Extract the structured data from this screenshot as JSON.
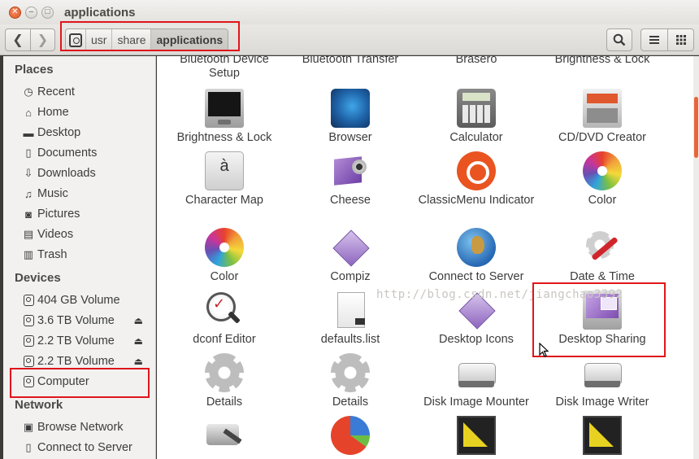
{
  "window": {
    "title": "applications"
  },
  "toolbar": {
    "back_icon": "chevron-left-icon",
    "forward_icon": "chevron-right-icon",
    "breadcrumbs": [
      "usr",
      "share",
      "applications"
    ],
    "search_icon": "search-icon",
    "list_view_icon": "list-view-icon",
    "grid_view_icon": "grid-view-icon"
  },
  "sidebar": {
    "places_heading": "Places",
    "places": [
      {
        "label": "Recent",
        "icon": "clock-icon"
      },
      {
        "label": "Home",
        "icon": "home-icon"
      },
      {
        "label": "Desktop",
        "icon": "folder-icon"
      },
      {
        "label": "Documents",
        "icon": "documents-icon"
      },
      {
        "label": "Downloads",
        "icon": "download-icon"
      },
      {
        "label": "Music",
        "icon": "music-icon"
      },
      {
        "label": "Pictures",
        "icon": "camera-icon"
      },
      {
        "label": "Videos",
        "icon": "film-icon"
      },
      {
        "label": "Trash",
        "icon": "trash-icon"
      }
    ],
    "devices_heading": "Devices",
    "devices": [
      {
        "label": "404 GB Volume",
        "eject": false
      },
      {
        "label": "3.6 TB Volume",
        "eject": true
      },
      {
        "label": "2.2 TB Volume",
        "eject": true
      },
      {
        "label": "2.2 TB Volume",
        "eject": true
      },
      {
        "label": "Computer",
        "eject": false
      }
    ],
    "network_heading": "Network",
    "network": [
      {
        "label": "Browse Network",
        "icon": "network-icon"
      },
      {
        "label": "Connect to Server",
        "icon": "server-icon"
      }
    ]
  },
  "content": {
    "watermark": "http://blog.csdn.net/jiangchao3392",
    "partial_top_row": [
      "Bluetooth Device Setup",
      "Bluetooth Transfer",
      "Brasero",
      "Brightness & Lock"
    ],
    "rows": [
      [
        "Brightness & Lock",
        "Browser",
        "Calculator",
        "CD/DVD Creator"
      ],
      [
        "Character Map",
        "Cheese",
        "ClassicMenu Indicator",
        "Color"
      ],
      [
        "Color",
        "Compiz",
        "Connect to Server",
        "Date & Time"
      ],
      [
        "dconf Editor",
        "defaults.list",
        "Desktop Icons",
        "Desktop Sharing"
      ],
      [
        "Details",
        "Details",
        "Disk Image Mounter",
        "Disk Image Writer"
      ]
    ],
    "bottom_row_icons": [
      "hard-disk-icon",
      "pie-chart-icon",
      "ruler-icon",
      "ruler-icon"
    ]
  },
  "colors": {
    "accent": "#e95420",
    "highlight": "#e0161b",
    "sidebar_bg": "#f2f1f0"
  }
}
